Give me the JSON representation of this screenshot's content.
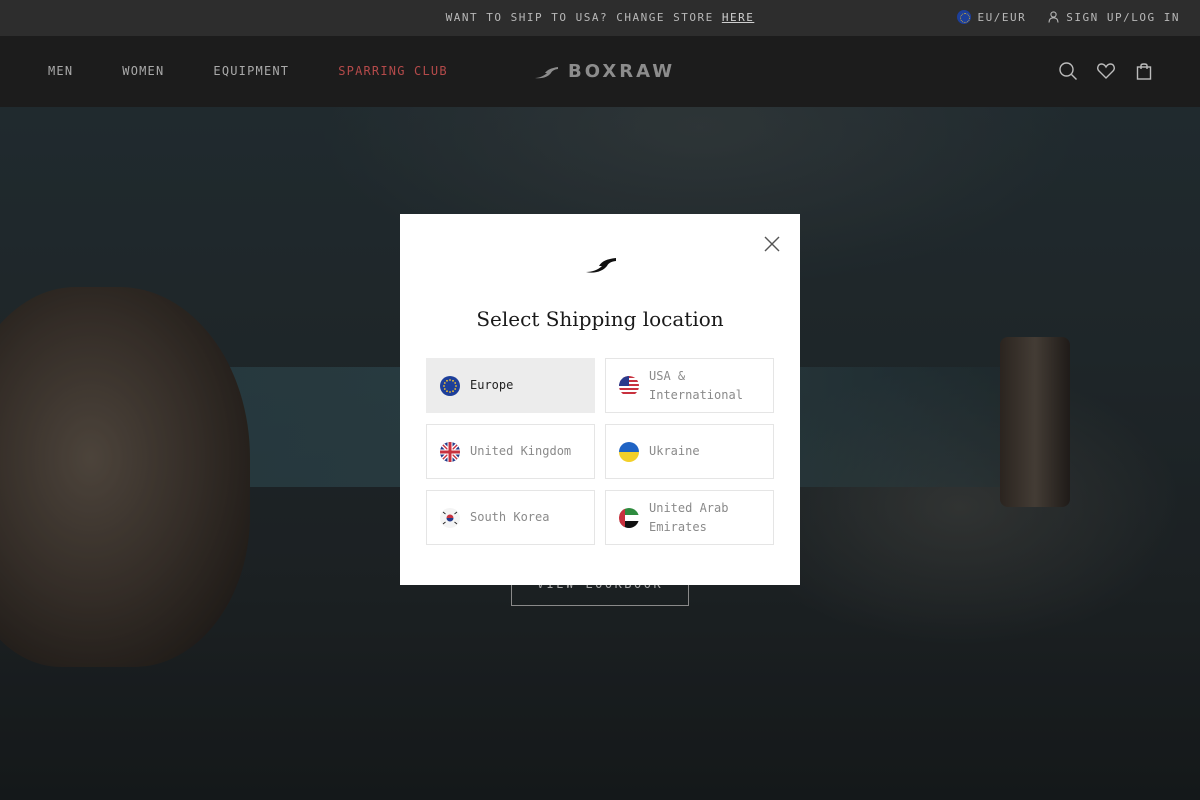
{
  "announcement": {
    "message": "WANT TO SHIP TO USA? CHANGE STORE",
    "link": "HERE",
    "currency": "EU/EUR",
    "account": "SIGN UP/LOG IN"
  },
  "nav": {
    "links": [
      "MEN",
      "WOMEN",
      "EQUIPMENT",
      "SPARRING CLUB"
    ],
    "brand": "BOXRAW",
    "icons": [
      "search-icon",
      "heart-icon",
      "bag-icon"
    ]
  },
  "hero": {
    "cta": "VIEW LOOKBOOK"
  },
  "modal": {
    "title": "Select Shipping location",
    "locations": [
      {
        "label": "Europe",
        "flag": "eu-flag-icon",
        "selected": true
      },
      {
        "label": "USA & International",
        "flag": "us-flag-icon",
        "selected": false
      },
      {
        "label": "United Kingdom",
        "flag": "uk-flag-icon",
        "selected": false
      },
      {
        "label": "Ukraine",
        "flag": "ukraine-flag-icon",
        "selected": false
      },
      {
        "label": "South Korea",
        "flag": "south-korea-flag-icon",
        "selected": false
      },
      {
        "label": "United Arab Emirates",
        "flag": "uae-flag-icon",
        "selected": false
      }
    ]
  },
  "colors": {
    "accent_red": "#b44a4a",
    "nav_bg": "#1c1c1c",
    "announce_bg": "#2d2d2d",
    "modal_bg": "#ffffff",
    "selected_bg": "#ececec"
  }
}
